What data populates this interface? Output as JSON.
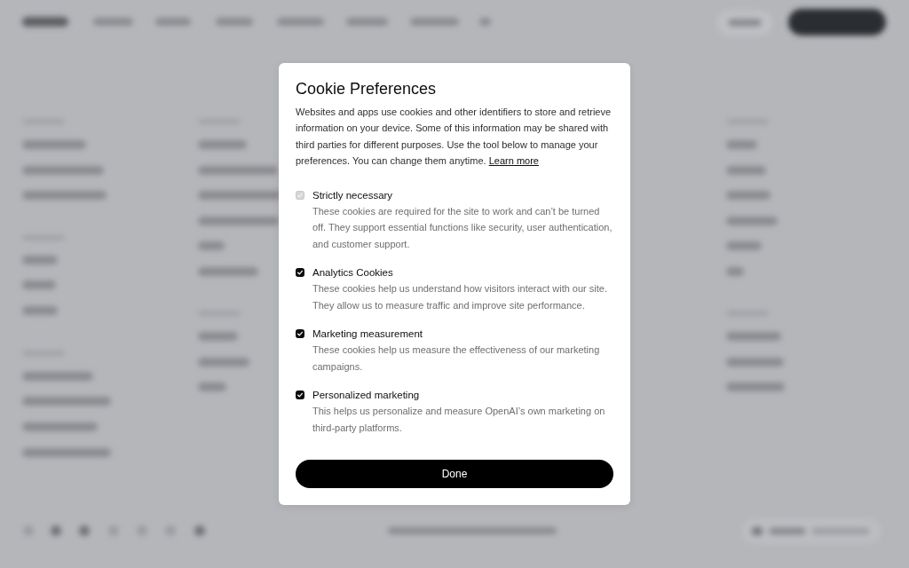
{
  "dialog": {
    "title": "Cookie Preferences",
    "intro": "Websites and apps use cookies and other identifiers to store and retrieve information on your device. Some of this information may be shared with third parties for different purposes. Use the tool below to manage your preferences. You can change them anytime.",
    "learn_more_link": "Learn more",
    "categories": [
      {
        "label": "Strictly necessary",
        "description": "These cookies are required for the site to work and can’t be turned off. They support essential functions like security, user authentication, and customer support.",
        "checked": true,
        "disabled": true
      },
      {
        "label": "Analytics Cookies",
        "description": "These cookies help us understand how visitors interact with our site. They allow us to measure traffic and improve site performance.",
        "checked": true,
        "disabled": false
      },
      {
        "label": "Marketing measurement",
        "description": "These cookies help us measure the effectiveness of our marketing campaigns.",
        "checked": true,
        "disabled": false
      },
      {
        "label": "Personalized marketing",
        "description": "This helps us personalize and measure OpenAI’s own marketing on third-party platforms.",
        "checked": true,
        "disabled": false
      }
    ],
    "done_button": "Done"
  }
}
